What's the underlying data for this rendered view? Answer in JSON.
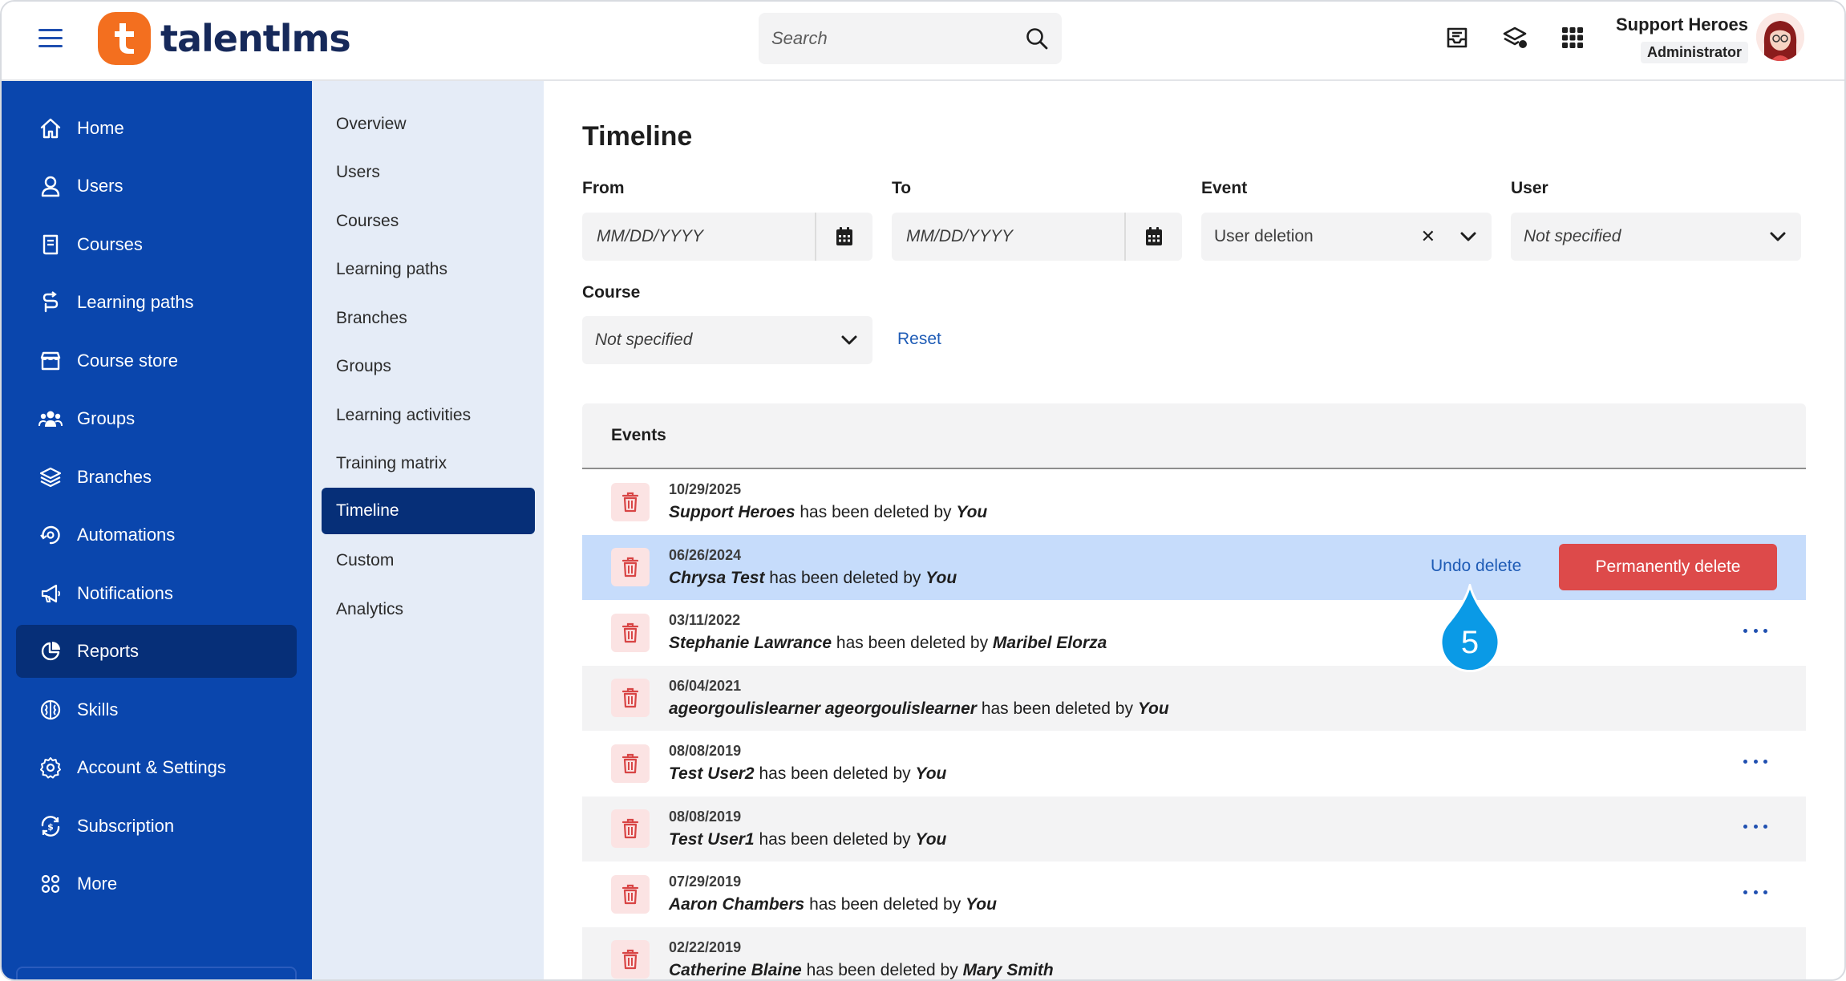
{
  "brand": {
    "name": "talentlms"
  },
  "header": {
    "search_placeholder": "Search",
    "user_name": "Support Heroes",
    "user_role": "Administrator"
  },
  "sidebar": {
    "items": [
      {
        "label": "Home",
        "icon": "home-icon"
      },
      {
        "label": "Users",
        "icon": "user-icon"
      },
      {
        "label": "Courses",
        "icon": "book-icon"
      },
      {
        "label": "Learning paths",
        "icon": "path-icon"
      },
      {
        "label": "Course store",
        "icon": "store-icon"
      },
      {
        "label": "Groups",
        "icon": "group-icon"
      },
      {
        "label": "Branches",
        "icon": "layers-icon"
      },
      {
        "label": "Automations",
        "icon": "automation-icon"
      },
      {
        "label": "Notifications",
        "icon": "megaphone-icon"
      },
      {
        "label": "Reports",
        "icon": "pie-chart-icon",
        "active": true
      },
      {
        "label": "Skills",
        "icon": "brain-icon"
      },
      {
        "label": "Account & Settings",
        "icon": "gear-icon"
      },
      {
        "label": "Subscription",
        "icon": "subscription-icon"
      },
      {
        "label": "More",
        "icon": "grid-dots-icon"
      }
    ]
  },
  "subnav": {
    "items": [
      {
        "label": "Overview"
      },
      {
        "label": "Users"
      },
      {
        "label": "Courses"
      },
      {
        "label": "Learning paths"
      },
      {
        "label": "Branches"
      },
      {
        "label": "Groups"
      },
      {
        "label": "Learning activities"
      },
      {
        "label": "Training matrix"
      },
      {
        "label": "Timeline",
        "active": true
      },
      {
        "label": "Custom"
      },
      {
        "label": "Analytics"
      }
    ]
  },
  "main": {
    "title": "Timeline",
    "filters": {
      "from_label": "From",
      "from_placeholder": "MM/DD/YYYY",
      "to_label": "To",
      "to_placeholder": "MM/DD/YYYY",
      "event_label": "Event",
      "event_value": "User deletion",
      "user_label": "User",
      "user_value": "Not specified",
      "course_label": "Course",
      "course_value": "Not specified",
      "reset": "Reset"
    },
    "events": {
      "header": "Events",
      "connector": "has been deleted by",
      "rows": [
        {
          "date": "10/29/2025",
          "subject": "Support Heroes",
          "actor": "You"
        },
        {
          "date": "06/26/2024",
          "subject": "Chrysa Test",
          "actor": "You",
          "selected": true
        },
        {
          "date": "03/11/2022",
          "subject": "Stephanie Lawrance",
          "actor": "Maribel Elorza"
        },
        {
          "date": "06/04/2021",
          "subject": "ageorgoulislearner ageorgoulislearner",
          "actor": "You"
        },
        {
          "date": "08/08/2019",
          "subject": "Test User2",
          "actor": "You"
        },
        {
          "date": "08/08/2019",
          "subject": "Test User1",
          "actor": "You"
        },
        {
          "date": "07/29/2019",
          "subject": "Aaron Chambers",
          "actor": "You"
        },
        {
          "date": "02/22/2019",
          "subject": "Catherine Blaine",
          "actor": "Mary Smith"
        }
      ],
      "undo_label": "Undo delete",
      "permanent_label": "Permanently delete"
    },
    "step_badge": "5"
  },
  "colors": {
    "sidebar": "#0a46ad",
    "sidebar_active": "#062f78",
    "subnav": "#e5ecf7",
    "brand_orange": "#f36f1f",
    "danger": "#dd4a4a",
    "selected_row": "#c6dcfb",
    "link": "#1f5cb6"
  }
}
